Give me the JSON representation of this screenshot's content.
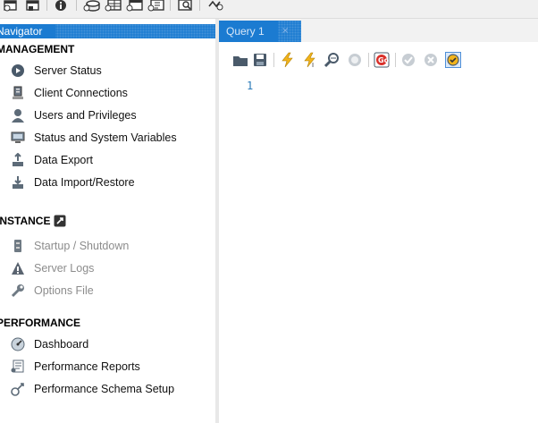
{
  "toolbar": {
    "icons": [
      "new-query-icon",
      "open-sql-script-icon",
      "info-icon",
      "create-schema-icon",
      "create-table-icon",
      "create-view-icon",
      "create-procedure-icon",
      "search-table-data-icon",
      "reconnect-icon"
    ]
  },
  "navigator": {
    "header": "Navigator",
    "sections": {
      "management": {
        "title": "MANAGEMENT",
        "items": [
          {
            "label": "Server Status",
            "icon": "server-status-icon"
          },
          {
            "label": "Client Connections",
            "icon": "client-connections-icon"
          },
          {
            "label": "Users and Privileges",
            "icon": "users-icon"
          },
          {
            "label": "Status and System Variables",
            "icon": "monitor-icon"
          },
          {
            "label": "Data Export",
            "icon": "data-export-icon"
          },
          {
            "label": "Data Import/Restore",
            "icon": "data-import-icon"
          }
        ]
      },
      "instance": {
        "title": "INSTANCE",
        "items": [
          {
            "label": "Startup / Shutdown",
            "icon": "startup-shutdown-icon"
          },
          {
            "label": "Server Logs",
            "icon": "warning-icon"
          },
          {
            "label": "Options File",
            "icon": "wrench-icon"
          }
        ]
      },
      "performance": {
        "title": "PERFORMANCE",
        "items": [
          {
            "label": "Dashboard",
            "icon": "dashboard-icon"
          },
          {
            "label": "Performance Reports",
            "icon": "reports-icon"
          },
          {
            "label": "Performance Schema Setup",
            "icon": "schema-setup-icon"
          }
        ]
      }
    }
  },
  "editor": {
    "tab_label": "Query 1",
    "tab_close": "×",
    "line_numbers": [
      "1"
    ]
  },
  "colors": {
    "accent": "#1b7bd1",
    "disabled_text": "#8c8c8c",
    "line_number": "#2a7ab8"
  }
}
